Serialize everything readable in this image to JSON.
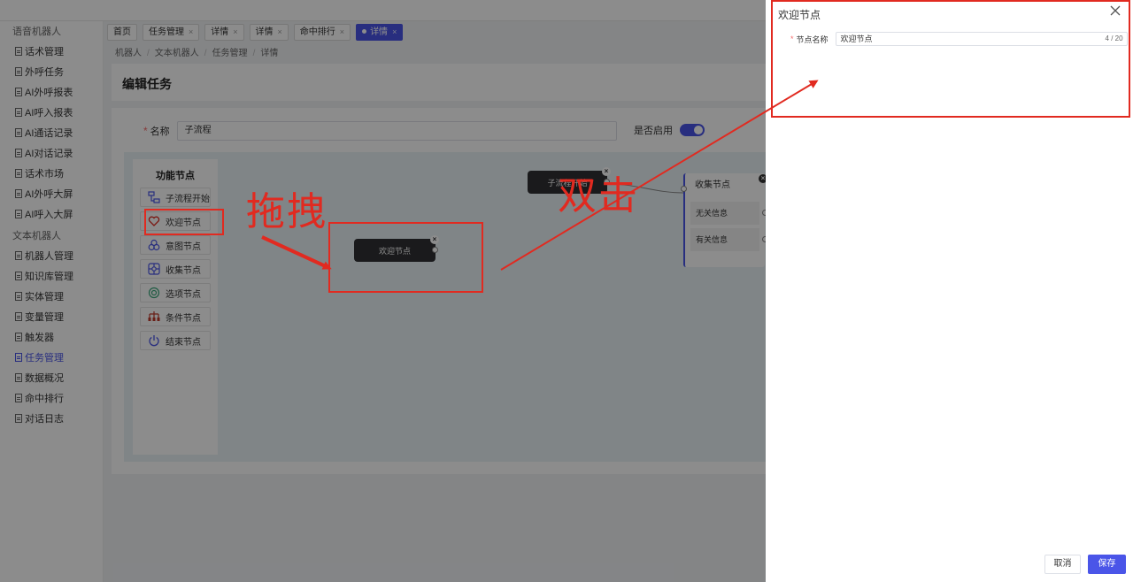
{
  "sidebar": {
    "group_voice": "语音机器人",
    "voice_items": [
      "话术管理",
      "外呼任务",
      "AI外呼报表",
      "AI呼入报表",
      "AI通话记录",
      "AI对话记录",
      "话术市场",
      "AI外呼大屏",
      "AI呼入大屏"
    ],
    "group_text": "文本机器人",
    "text_items": [
      "机器人管理",
      "知识库管理",
      "实体管理",
      "变量管理",
      "触发器",
      "任务管理",
      "数据概况",
      "命中排行",
      "对话日志"
    ],
    "active_item": "任务管理"
  },
  "tabs": [
    {
      "label": "首页",
      "closable": false,
      "active": false
    },
    {
      "label": "任务管理",
      "closable": true,
      "active": false
    },
    {
      "label": "详情",
      "closable": true,
      "active": false
    },
    {
      "label": "详情",
      "closable": true,
      "active": false
    },
    {
      "label": "命中排行",
      "closable": true,
      "active": false
    },
    {
      "label": "详情",
      "closable": true,
      "active": true
    }
  ],
  "tab_close_glyph": "×",
  "breadcrumb": [
    "机器人",
    "文本机器人",
    "任务管理",
    "详情"
  ],
  "breadcrumb_sep": "/",
  "page": {
    "title": "编辑任务",
    "name_label": "名称",
    "name_value": "子流程",
    "enable_label": "是否启用",
    "enabled": true,
    "required_mark": "*"
  },
  "palette": {
    "title": "功能节点",
    "items": [
      {
        "label": "子流程开始",
        "icon": "flow-start-icon",
        "color": "#4a55e8"
      },
      {
        "label": "欢迎节点",
        "icon": "heart-icon",
        "color": "#e12a20"
      },
      {
        "label": "意图节点",
        "icon": "intent-icon",
        "color": "#4a55e8"
      },
      {
        "label": "收集节点",
        "icon": "collect-icon",
        "color": "#4a55e8"
      },
      {
        "label": "选项节点",
        "icon": "option-icon",
        "color": "#3aa77a"
      },
      {
        "label": "条件节点",
        "icon": "condition-icon",
        "color": "#c0392b"
      },
      {
        "label": "结束节点",
        "icon": "power-icon",
        "color": "#4a55e8"
      }
    ]
  },
  "canvas": {
    "subflow_node": "子流程开始",
    "welcome_node": "欢迎节点",
    "collect_node": {
      "title": "收集节点",
      "options": [
        "无关信息",
        "有关信息"
      ]
    }
  },
  "drawer": {
    "title": "欢迎节点",
    "field_label": "节点名称",
    "field_value": "欢迎节点",
    "field_count": "4 / 20",
    "cancel": "取消",
    "save": "保存"
  },
  "annotations": {
    "drag": "拖拽",
    "double_click": "双击",
    "color": "#e12a20"
  },
  "colors": {
    "accent": "#4a55e8",
    "annotation": "#e12a20",
    "node_dark": "#303133"
  }
}
